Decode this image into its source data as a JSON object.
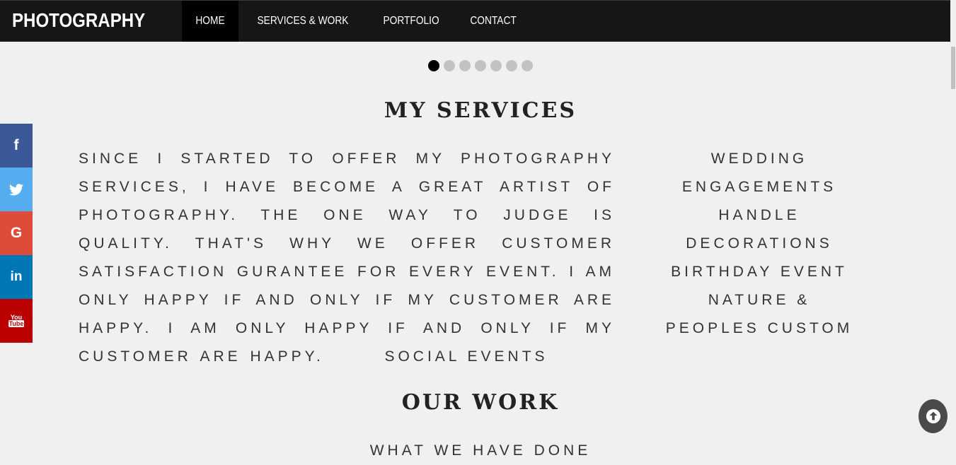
{
  "header": {
    "brand": "PHOTOGRAPHY",
    "nav": [
      "HOME",
      "SERVICES & WORK",
      "PORTFOLIO",
      "CONTACT"
    ],
    "active": "HOME"
  },
  "carousel": {
    "slide_count": 7,
    "active_index": 0
  },
  "services": {
    "title": "MY SERVICES",
    "description": "Since I started to offer my photography services, I have become a great artist of photography. The one way to judge is quality. That's why we offer customer satisfaction gurantee for every event. I am only happy if and only if my customer are happy. I am only happy if and only if my customer are happy.",
    "list": [
      "WEDDING",
      "ENGAGEMENTS",
      "HANDLE",
      "DECORATIONS",
      "BIRTHDAY EVENT",
      "NATURE &",
      "PEOPLES CUSTOM"
    ],
    "list_tail": "SOCIAL EVENTS"
  },
  "work": {
    "title": "OUR WORK",
    "subtitle": "WHAT WE HAVE DONE"
  },
  "social_links": [
    {
      "name": "facebook",
      "glyph": "f",
      "color": "#3b5998"
    },
    {
      "name": "twitter",
      "glyph": "t",
      "color": "#55acee"
    },
    {
      "name": "google-plus",
      "glyph": "G",
      "color": "#dd4b39"
    },
    {
      "name": "linkedin",
      "glyph": "in",
      "color": "#0077b5"
    },
    {
      "name": "youtube",
      "glyph": "You Tube",
      "color": "#bb0000"
    }
  ],
  "colors": {
    "navbar": "#161616",
    "background": "#f0f0f0",
    "active_nav": "#000000"
  }
}
